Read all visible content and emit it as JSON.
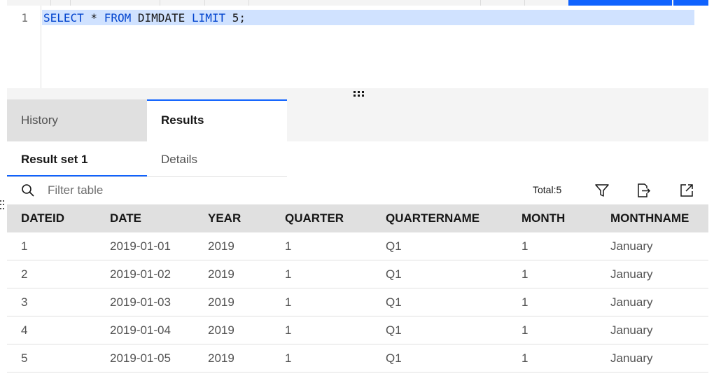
{
  "editor": {
    "line_number": "1",
    "tokens": [
      {
        "text": "SELECT",
        "kw": true
      },
      {
        "text": " * ",
        "kw": false
      },
      {
        "text": "FROM",
        "kw": true
      },
      {
        "text": " DIMDATE ",
        "kw": false
      },
      {
        "text": "LIMIT",
        "kw": true
      },
      {
        "text": " 5;",
        "kw": false
      }
    ]
  },
  "tabs": {
    "history": "History",
    "results": "Results"
  },
  "subtabs": {
    "result_set": "Result set 1",
    "details": "Details"
  },
  "toolbar": {
    "filter_placeholder": "Filter table",
    "total": "Total:5"
  },
  "icons": {
    "search": "search-icon",
    "filter": "filter-icon",
    "export": "export-icon",
    "launch": "launch-icon",
    "drag": "drag-handle-icon"
  },
  "colors": {
    "accent": "#0f62fe",
    "selection": "#d0e2ff",
    "keyword": "#0043ce"
  },
  "table": {
    "columns": [
      "DATEID",
      "DATE",
      "YEAR",
      "QUARTER",
      "QUARTERNAME",
      "MONTH",
      "MONTHNAME"
    ],
    "rows": [
      [
        "1",
        "2019-01-01",
        "2019",
        "1",
        "Q1",
        "1",
        "January"
      ],
      [
        "2",
        "2019-01-02",
        "2019",
        "1",
        "Q1",
        "1",
        "January"
      ],
      [
        "3",
        "2019-01-03",
        "2019",
        "1",
        "Q1",
        "1",
        "January"
      ],
      [
        "4",
        "2019-01-04",
        "2019",
        "1",
        "Q1",
        "1",
        "January"
      ],
      [
        "5",
        "2019-01-05",
        "2019",
        "1",
        "Q1",
        "1",
        "January"
      ]
    ]
  }
}
